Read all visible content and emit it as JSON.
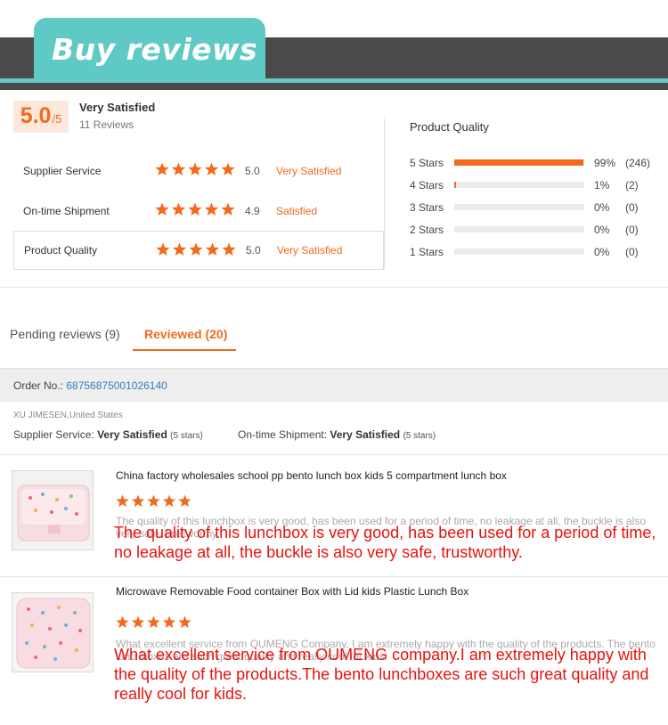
{
  "banner": {
    "title": "Buy reviews"
  },
  "summary": {
    "score": "5.0",
    "score_suffix": "/5",
    "satisfaction": "Very Satisfied",
    "review_count": "11 Reviews"
  },
  "metrics": [
    {
      "label": "Supplier Service",
      "stars": 5,
      "score": "5.0",
      "text": "Very Satisfied"
    },
    {
      "label": "On-time Shipment",
      "stars": 5,
      "score": "4.9",
      "text": "Satisfied"
    },
    {
      "label": "Product Quality",
      "stars": 5,
      "score": "5.0",
      "text": "Very Satisfied"
    }
  ],
  "product_quality": {
    "title": "Product Quality",
    "rows": [
      {
        "label": "5 Stars",
        "fraction": 0.99,
        "pct": "99%",
        "count": "(246)"
      },
      {
        "label": "4 Stars",
        "fraction": 0.01,
        "pct": "1%",
        "count": "(2)"
      },
      {
        "label": "3 Stars",
        "fraction": 0,
        "pct": "0%",
        "count": "(0)"
      },
      {
        "label": "2 Stars",
        "fraction": 0,
        "pct": "0%",
        "count": "(0)"
      },
      {
        "label": "1 Stars",
        "fraction": 0,
        "pct": "0%",
        "count": "(0)"
      }
    ]
  },
  "tabs": {
    "pending": "Pending reviews (9)",
    "reviewed": "Reviewed (20)"
  },
  "order": {
    "label": "Order No.:",
    "number": "68756875001026140",
    "buyer": "XU JIMESEN,United States",
    "supplier_label": "Supplier Service:",
    "supplier_value": "Very Satisfied",
    "supplier_note": "(5 stars)",
    "shipment_label": "On-time Shipment:",
    "shipment_value": "Very Satisfied",
    "shipment_note": "(5 stars)"
  },
  "colors": {
    "accent": "#f26a1b",
    "teal": "#5fc9c5",
    "banner_dark": "#4a4a4a",
    "overlay_red": "#e8120c",
    "link": "#3a78c3"
  },
  "reviews": [
    {
      "product": "China factory wholesales school pp bento lunch box kids 5 compartment lunch box",
      "stars": 5,
      "text_small": "The quality of this lunchbox is very good, has been used for a period of time, no leakage at all, the buckle is also very safe, trustworthy.",
      "text_large": "The quality of this lunchbox is very good, has been used for a period of time, no leakage at all, the buckle is also very safe, trustworthy."
    },
    {
      "product": "Microwave Removable Food container  Box with Lid kids Plastic Lunch Box",
      "stars": 5,
      "text_small": "What excellent service from OUMENG Company. I am extremely happy with the quality of the products. The bento lunchboxes are such great quality and really cool for kids.",
      "text_large": "What excellent service from OUMENG company.I am extremely happy with the quality of the products.The bento lunchboxes are such great quality and really cool for kids."
    }
  ]
}
